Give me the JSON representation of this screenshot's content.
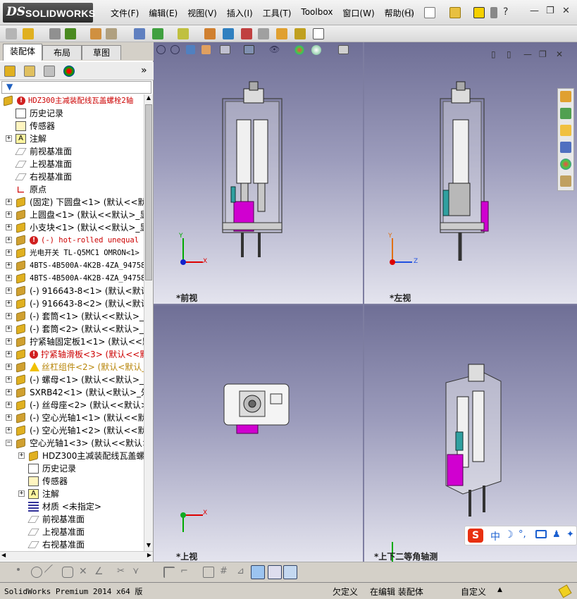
{
  "app": {
    "logo_ds": "DS",
    "logo_name": "SOLIDWORKS"
  },
  "menu": [
    "文件(F)",
    "编辑(E)",
    "视图(V)",
    "插入(I)",
    "工具(T)",
    "Toolbox",
    "窗口(W)",
    "帮助(H)"
  ],
  "tabs": [
    "装配体",
    "布局",
    "草图"
  ],
  "tree": [
    {
      "label": "HDZ300主减装配线瓦盖螺栓2轴",
      "style": "red-root",
      "indent": 0
    },
    {
      "label": "历史记录",
      "indent": 1
    },
    {
      "label": "传感器",
      "indent": 1
    },
    {
      "label": "注解",
      "indent": 1,
      "exp": true
    },
    {
      "label": "前视基准面",
      "indent": 1
    },
    {
      "label": "上视基准面",
      "indent": 1
    },
    {
      "label": "右视基准面",
      "indent": 1
    },
    {
      "label": "原点",
      "indent": 1
    },
    {
      "label": "(固定) 下圆盘<1> (默认<<默",
      "indent": 1,
      "exp": true
    },
    {
      "label": "上圆盘<1> (默认<<默认>_显示",
      "indent": 1,
      "exp": true
    },
    {
      "label": "小支块<1> (默认<<默认>_显",
      "indent": 1,
      "exp": true
    },
    {
      "label": "(-) hot-rolled unequal a",
      "indent": 1,
      "exp": true,
      "style": "red-mono"
    },
    {
      "label": "光电开关 TL-Q5MC1 OMRON<1>",
      "indent": 1,
      "exp": true,
      "style": "mono"
    },
    {
      "label": "4BTS-4B500A-4K2B-4ZA_947589",
      "indent": 1,
      "exp": true,
      "style": "mono"
    },
    {
      "label": "4BTS-4B500A-4K2B-4ZA_947589",
      "indent": 1,
      "exp": true,
      "style": "mono"
    },
    {
      "label": "(-) 916643-8<1> (默认<默认",
      "indent": 1,
      "exp": true
    },
    {
      "label": "(-) 916643-8<2> (默认<默认",
      "indent": 1,
      "exp": true
    },
    {
      "label": "(-) 套筒<1> (默认<<默认>_显",
      "indent": 1,
      "exp": true
    },
    {
      "label": "(-) 套筒<2> (默认<<默认>_显",
      "indent": 1,
      "exp": true
    },
    {
      "label": "拧紧轴固定板1<1> (默认<<默认",
      "indent": 1,
      "exp": true
    },
    {
      "label": "拧紧轴滑板<3> (默认<<默认",
      "indent": 1,
      "exp": true,
      "style": "red-err"
    },
    {
      "label": "丝杠组件<2> (默认<默认_显",
      "indent": 1,
      "exp": true,
      "style": "yel-warn"
    },
    {
      "label": "(-) 螺母<1> (默认<<默认>_显",
      "indent": 1,
      "exp": true
    },
    {
      "label": "SXRB42<1> (默认<默认>_外观",
      "indent": 1,
      "exp": true
    },
    {
      "label": "(-) 丝母座<2> (默认<<默认>_",
      "indent": 1,
      "exp": true
    },
    {
      "label": "(-) 空心光轴1<1> (默认<<默认",
      "indent": 1,
      "exp": true
    },
    {
      "label": "(-) 空心光轴1<2> (默认<<默认",
      "indent": 1,
      "exp": true
    },
    {
      "label": "空心光轴1<3> (默认<<默认>_显",
      "indent": 1,
      "exp": true,
      "open": true
    },
    {
      "label": "HDZ300主减装配线瓦盖螺栓",
      "indent": 2,
      "exp": true
    },
    {
      "label": "历史记录",
      "indent": 2
    },
    {
      "label": "传感器",
      "indent": 2
    },
    {
      "label": "注解",
      "indent": 2,
      "exp": true
    },
    {
      "label": "材质 <未指定>",
      "indent": 2
    },
    {
      "label": "前视基准面",
      "indent": 2
    },
    {
      "label": "上视基准面",
      "indent": 2
    },
    {
      "label": "右视基准面",
      "indent": 2
    }
  ],
  "viewports": {
    "front": "*前视",
    "left": "*左视",
    "top": "*上视",
    "iso": "*上下二等角轴测"
  },
  "axes": {
    "x": "X",
    "y": "Y",
    "z": "Z"
  },
  "ime": {
    "chars": [
      "中",
      "°,"
    ]
  },
  "status": {
    "app": "SolidWorks Premium 2014 x64 版",
    "def": "欠定义",
    "mode": "在编辑 装配体",
    "custom": "自定义"
  },
  "colors": {
    "accent": "#c00000",
    "magenta": "#d000d0",
    "sky": "#6f6f96"
  }
}
